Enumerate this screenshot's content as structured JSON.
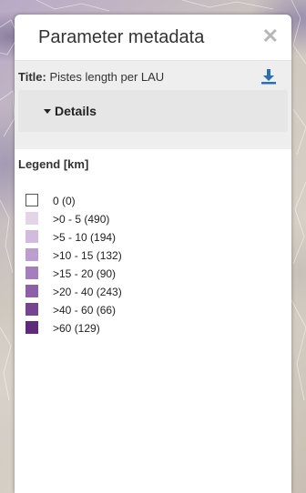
{
  "panel": {
    "title": "Parameter metadata",
    "close_symbol": "✕"
  },
  "metadata": {
    "title_key": "Title:",
    "title_value": "Pistes length per LAU",
    "download_icon": "download-icon",
    "details_label": "Details"
  },
  "legend": {
    "title": "Legend [km]",
    "items": [
      {
        "label": "0 (0)",
        "color": "#ffffff"
      },
      {
        "label": ">0 - 5 (490)",
        "color": "#e4d4ea"
      },
      {
        "label": ">5 - 10 (194)",
        "color": "#d2bbdf"
      },
      {
        "label": ">10 - 15 (132)",
        "color": "#bc9fd0"
      },
      {
        "label": ">15 - 20 (90)",
        "color": "#a57fbc"
      },
      {
        "label": ">20 - 40 (243)",
        "color": "#8d60a7"
      },
      {
        "label": ">40 - 60 (66)",
        "color": "#764590"
      },
      {
        "label": ">60 (129)",
        "color": "#5e2a79"
      }
    ]
  }
}
